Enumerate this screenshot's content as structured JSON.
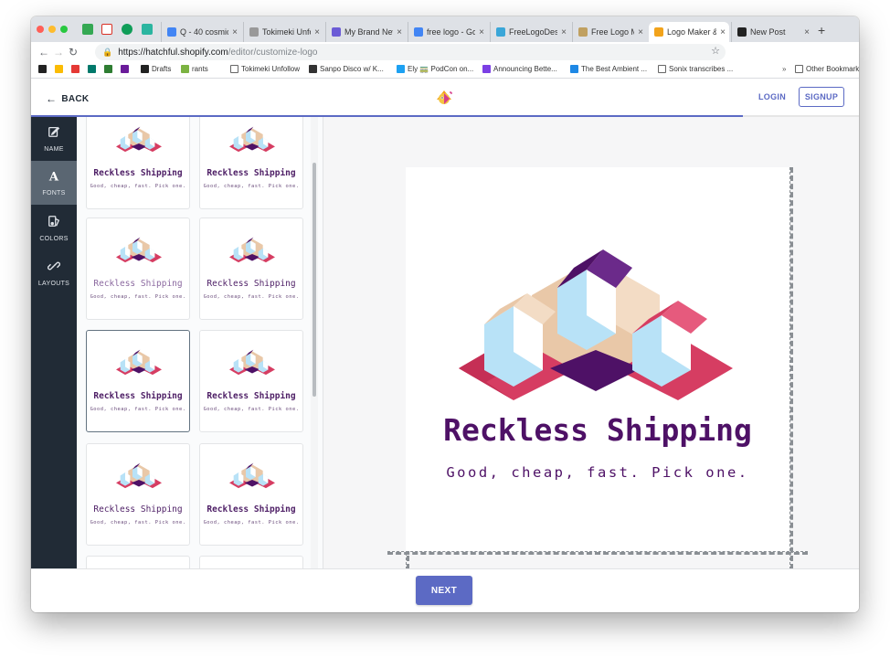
{
  "browser": {
    "tabs": [
      {
        "title": "Q - 40 cosmic",
        "favicon": "google-icon",
        "color": "#4285f4"
      },
      {
        "title": "Tokimeki Unfollow",
        "favicon": "document-icon",
        "color": "#999999"
      },
      {
        "title": "My Brand New",
        "favicon": "bot-icon",
        "color": "#6b5bd6"
      },
      {
        "title": "free logo - Go",
        "favicon": "google-icon",
        "color": "#4285f4"
      },
      {
        "title": "FreeLogoDesign",
        "favicon": "globe-icon",
        "color": "#3aa6d8"
      },
      {
        "title": "Free Logo Make",
        "favicon": "grid-icon",
        "color": "#c0a060"
      },
      {
        "title": "Logo Maker &",
        "favicon": "hatchful-icon",
        "color": "#f2a31b"
      },
      {
        "title": "New Post",
        "favicon": "glitch-icon",
        "color": "#222222"
      }
    ],
    "url_host": "https://hatchful.shopify.com",
    "url_path": "/editor/customize-logo",
    "bookmarks": [
      {
        "label": "Drafts",
        "color": "#222222"
      },
      {
        "label": "rants",
        "color": "#7cb342"
      },
      {
        "label": "Tokimeki Unfollow",
        "color": "#ffffff"
      },
      {
        "label": "Sanpo Disco w/ K...",
        "color": "#333333"
      },
      {
        "label": "Ely 🚃 PodCon on...",
        "color": "#1da1f2"
      },
      {
        "label": "Announcing Bette...",
        "color": "#7b3fe4"
      },
      {
        "label": "The Best Ambient ...",
        "color": "#1e88e5"
      },
      {
        "label": "Sonix transcribes ...",
        "color": "#ffffff"
      }
    ],
    "overflow": "»",
    "other_bookmarks": "Other Bookmarks"
  },
  "header": {
    "back_label": "BACK",
    "login_label": "LOGIN",
    "signup_label": "SIGNUP",
    "progress_percent": 86
  },
  "sidenav": [
    {
      "label": "NAME",
      "icon": "edit-icon",
      "active": false
    },
    {
      "label": "FONTS",
      "icon": "font-icon",
      "active": true
    },
    {
      "label": "COLORS",
      "icon": "palette-icon",
      "active": false
    },
    {
      "label": "LAYOUTS",
      "icon": "layout-icon",
      "active": false
    }
  ],
  "font_options": [
    {
      "title": "Reckless Shipping",
      "tagline": "Good, cheap, fast. Pick one.",
      "style": "bold"
    },
    {
      "title": "Reckless Shipping",
      "tagline": "Good, cheap, fast. Pick one.",
      "style": "bold"
    },
    {
      "title": "Reckless Shipping",
      "tagline": "Good, cheap, fast. Pick one.",
      "style": "light"
    },
    {
      "title": "Reckless Shipping",
      "tagline": "Good, cheap, fast. Pick one.",
      "style": "regular"
    },
    {
      "title": "Reckless Shipping",
      "tagline": "Good, cheap, fast. Pick one.",
      "style": "bold",
      "selected": true
    },
    {
      "title": "Reckless Shipping",
      "tagline": "Good, cheap, fast. Pick one.",
      "style": "bold"
    },
    {
      "title": "Reckless Shipping",
      "tagline": "Good, cheap, fast. Pick one.",
      "style": "regular"
    },
    {
      "title": "Reckless Shipping",
      "tagline": "Good, cheap, fast. Pick one.",
      "style": "bold"
    }
  ],
  "preview": {
    "title": "Reckless Shipping",
    "tagline": "Good, cheap, fast. Pick one."
  },
  "footer": {
    "next_label": "NEXT"
  },
  "colors": {
    "accent": "#5c6ac4",
    "brand_purple": "#4e1166",
    "logo_pink": "#d63d62",
    "logo_tan": "#e9c8a8",
    "logo_blue": "#b8e2f7",
    "sidenav_bg": "#212b36"
  }
}
